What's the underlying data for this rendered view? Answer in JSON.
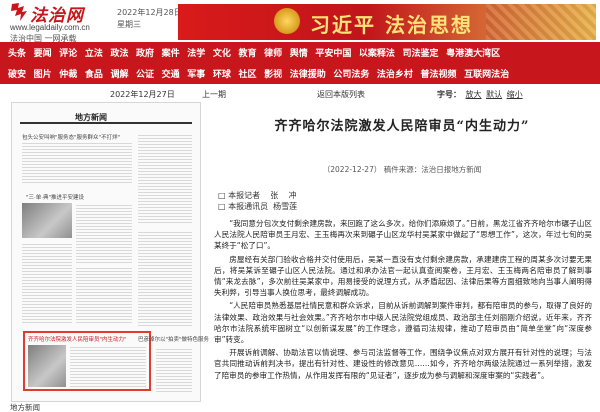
{
  "header": {
    "logo_name": "法治网",
    "logo_url": "www.legaldaily.com.cn",
    "logo_slogan": "法治中国 一网承载",
    "date": "2022年12月28日",
    "weekday": "星期三",
    "banner_text": "习近平 法治思想",
    "brand_color": "#c8161d"
  },
  "nav": {
    "row1": [
      "头条",
      "要闻",
      "评论",
      "立法",
      "政法",
      "政府",
      "案件",
      "法学",
      "文化",
      "教育",
      "律师",
      "舆情",
      "平安中国",
      "以案释法",
      "司法鉴定",
      "粤港澳大湾区"
    ],
    "row2": [
      "破安",
      "图片",
      "仲裁",
      "食品",
      "调解",
      "公证",
      "交通",
      "军事",
      "环球",
      "社区",
      "影视",
      "法律援助",
      "公司法务",
      "法治乡村",
      "普法视频",
      "互联网法治"
    ]
  },
  "toolbar": {
    "date": "2022年12月27日",
    "prev": "上一期",
    "print": "返回本版列表",
    "utils_label": "字号：",
    "font_large": "放大",
    "font_default": "默认",
    "font_small": "缩小"
  },
  "thumb": {
    "section": "地方新闻",
    "headlines": [
      "包头公安叫响\"服务态\"服务群众\"不打烊\"",
      "\"三·单·典\"推进平安建设",
      "齐齐哈尔法院激发人民陪审员\"内生动力\"",
      "巴彦淖尔以\"拍卖\"做特色服务"
    ]
  },
  "article": {
    "title": "齐齐哈尔法院激发人民陪审员“内生动力”",
    "meta": "（2022-12-27）  稿件来源：法治日报地方新闻",
    "byline": [
      "□ 本报记者    张    冲",
      "□ 本报通讯员  杨雪莲"
    ],
    "paragraphs": [
      "“我同意分包次支付剩余建房款，来回跑了这么多次，给你们添麻烦了。”日前，黑龙江省齐齐哈尔市碾子山区人民法院人民陪审员王月宏、王玉梅再次来到碾子山区龙华村吴某家中做起了“思想工作”，这次，年过七旬的吴某终于“松了口”。",
      "房屋经有关部门验收合格并交付使用后，吴某一直没有支付剩余建房款，承建建房工程的周某多次讨要无果后，将吴某诉至碾子山区人民法院。通过和承办法官一起认真查阅案卷，王月宏、王玉梅两名陪审员了解到事情“来龙去脉”，多次前往吴某家中，用易接受的说理方式，从矛盾起因、法律后果等方面细致地向当事人阐明得失利弊，引导当事人换位思考，最终调解成功。",
      "“人民陪审员熟悉基层社情民意和群众诉求，目前从诉前调解到案件审判，都有陪审员的参与，取得了良好的法律效果、政治效果与社会效果。”齐齐哈尔市中级人民法院党组成员、政治部主任刘丽刚介绍说，近年来，齐齐哈尔市法院系统牢固树立“以创新谋发展”的工作理念，遵循司法规律，推动了陪审员由“简单坐堂”向“深度参审”转变。",
      "开展诉前调解、协助法官以情说理、参与司法监督等工作，围绕争议焦点对双方展开有针对性的说理；与法官共同推动诉前判决书，提出有针对性、建设性的修改意见……如今，齐齐哈尔两级法院通过一系列举措，激发了陪审员的参审工作热情，从作用发挥有限的“见证者”，逐步成为参与调解和深度审案的“实践者”。"
    ]
  },
  "footer_label": "地方新闻"
}
